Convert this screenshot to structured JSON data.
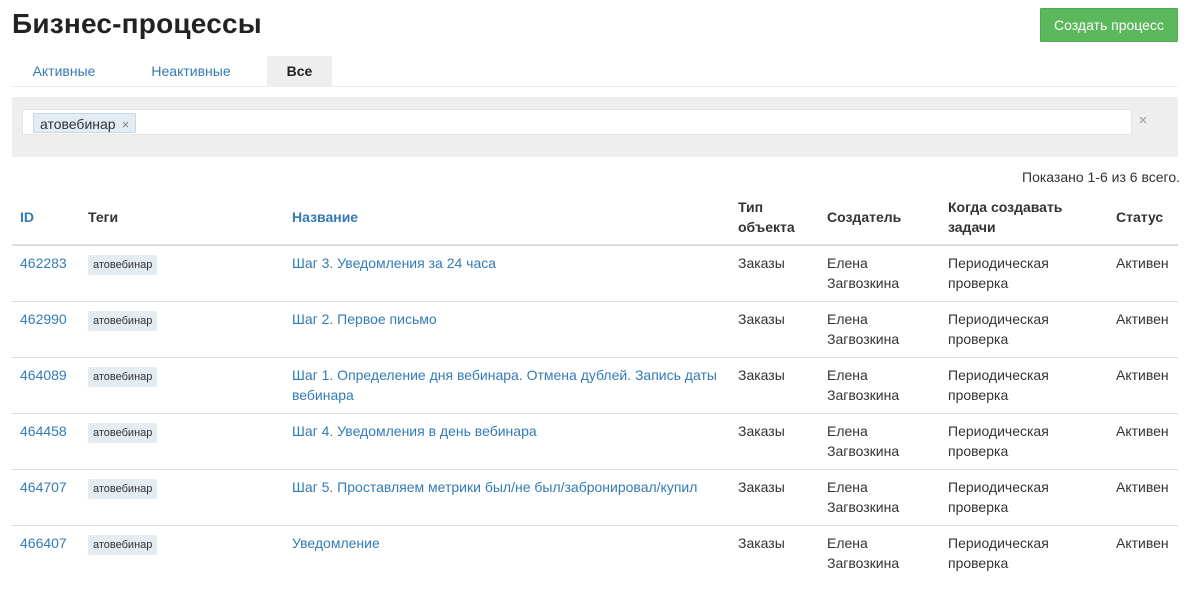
{
  "page": {
    "title": "Бизнес-процессы",
    "create_button": "Создать процесс"
  },
  "tabs": [
    {
      "label": "Активные",
      "active": false
    },
    {
      "label": "Неактивные",
      "active": false
    },
    {
      "label": "Все",
      "active": true
    }
  ],
  "filter": {
    "chip": "атовебинар",
    "chip_remove": "×",
    "clear": "×"
  },
  "summary": "Показано 1-6 из 6 всего.",
  "table": {
    "headers": {
      "id": "ID",
      "tags": "Теги",
      "name": "Название",
      "object_type_line1": "Тип",
      "object_type_line2": "объекта",
      "creator": "Создатель",
      "when_line1": "Когда создавать",
      "when_line2": "задачи",
      "status": "Статус"
    },
    "rows": [
      {
        "id": "462283",
        "tag": "атовебинар",
        "name": "Шаг 3. Уведомления за 24 часа",
        "type": "Заказы",
        "creator_first": "Елена",
        "creator_last": "Загвозкина",
        "when_line1": "Периодическая",
        "when_line2": "проверка",
        "status": "Активен"
      },
      {
        "id": "462990",
        "tag": "атовебинар",
        "name": "Шаг 2. Первое письмо",
        "type": "Заказы",
        "creator_first": "Елена",
        "creator_last": "Загвозкина",
        "when_line1": "Периодическая",
        "when_line2": "проверка",
        "status": "Активен"
      },
      {
        "id": "464089",
        "tag": "атовебинар",
        "name": "Шаг 1. Определение дня вебинара. Отмена дублей. Запись даты вебинара",
        "type": "Заказы",
        "creator_first": "Елена",
        "creator_last": "Загвозкина",
        "when_line1": "Периодическая",
        "when_line2": "проверка",
        "status": "Активен"
      },
      {
        "id": "464458",
        "tag": "атовебинар",
        "name": "Шаг 4. Уведомления в день вебинара",
        "type": "Заказы",
        "creator_first": "Елена",
        "creator_last": "Загвозкина",
        "when_line1": "Периодическая",
        "when_line2": "проверка",
        "status": "Активен"
      },
      {
        "id": "464707",
        "tag": "атовебинар",
        "name": "Шаг 5. Проставляем метрики был/не был/забронировал/купил",
        "type": "Заказы",
        "creator_first": "Елена",
        "creator_last": "Загвозкина",
        "when_line1": "Периодическая",
        "when_line2": "проверка",
        "status": "Активен"
      },
      {
        "id": "466407",
        "tag": "атовебинар",
        "name": "Уведомление",
        "type": "Заказы",
        "creator_first": "Елена",
        "creator_last": "Загвозкина",
        "when_line1": "Периодическая",
        "when_line2": "проверка",
        "status": "Активен"
      }
    ]
  },
  "colors": {
    "link": "#337ab7",
    "create_button": "#5cb85c",
    "tag_background": "#e3ebf3",
    "panel_background": "#eeeeee"
  }
}
